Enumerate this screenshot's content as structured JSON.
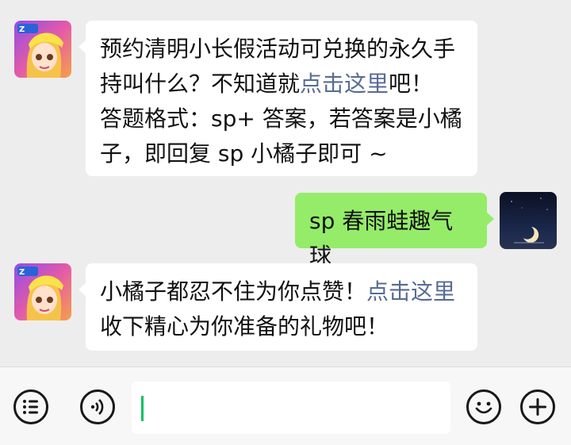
{
  "messages": [
    {
      "direction": "incoming",
      "lines": [
        {
          "text": "预约清明小长假活动可兑换的永久手"
        },
        {
          "text": "持叫什么？不知道就",
          "link": "点击这里",
          "after": "吧！"
        },
        {
          "text": "答题格式：sp+ 答案，若答案是小橘"
        },
        {
          "text": "子，即回复 sp 小橘子即可 ~"
        }
      ]
    },
    {
      "direction": "outgoing",
      "text": "sp 春雨蛙趣气球"
    },
    {
      "direction": "incoming",
      "lines": [
        {
          "text": "小橘子都忍不住为你点赞！",
          "link": "点击这里"
        },
        {
          "text": "收下精心为你准备的礼物吧！"
        }
      ]
    }
  ],
  "icons": {
    "menu": "list-menu-icon",
    "voice": "voice-icon",
    "emoji": "emoji-icon",
    "add": "plus-icon"
  },
  "colors": {
    "background": "#ededed",
    "incoming_bubble": "#ffffff",
    "outgoing_bubble": "#95ec69",
    "link": "#576b95",
    "cursor": "#07c160"
  }
}
